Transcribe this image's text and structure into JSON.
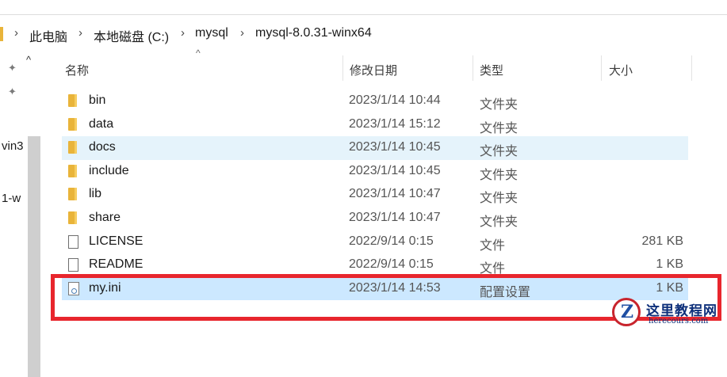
{
  "breadcrumb": {
    "separator": "›",
    "items": [
      "此电脑",
      "本地磁盘 (C:)",
      "mysql",
      "mysql-8.0.31-winx64"
    ]
  },
  "nav": {
    "fragments": [
      "vin3",
      "1-w"
    ],
    "pin_icon": "pin-icon",
    "scroll_up_glyph": "^"
  },
  "columns": {
    "name": "名称",
    "modified": "修改日期",
    "type": "类型",
    "size": "大小",
    "sort_glyph": "^"
  },
  "files": [
    {
      "name": "bin",
      "modified": "2023/1/14 10:44",
      "type": "文件夹",
      "size": "",
      "icon": "folder-icon"
    },
    {
      "name": "data",
      "modified": "2023/1/14 15:12",
      "type": "文件夹",
      "size": "",
      "icon": "folder-icon"
    },
    {
      "name": "docs",
      "modified": "2023/1/14 10:45",
      "type": "文件夹",
      "size": "",
      "icon": "folder-icon"
    },
    {
      "name": "include",
      "modified": "2023/1/14 10:45",
      "type": "文件夹",
      "size": "",
      "icon": "folder-icon"
    },
    {
      "name": "lib",
      "modified": "2023/1/14 10:47",
      "type": "文件夹",
      "size": "",
      "icon": "folder-icon"
    },
    {
      "name": "share",
      "modified": "2023/1/14 10:47",
      "type": "文件夹",
      "size": "",
      "icon": "folder-icon"
    },
    {
      "name": "LICENSE",
      "modified": "2022/9/14 0:15",
      "type": "文件",
      "size": "281 KB",
      "icon": "file-icon"
    },
    {
      "name": "README",
      "modified": "2022/9/14 0:15",
      "type": "文件",
      "size": "1 KB",
      "icon": "file-icon"
    },
    {
      "name": "my.ini",
      "modified": "2023/1/14 14:53",
      "type": "配置设置",
      "size": "1 KB",
      "icon": "config-file-icon"
    }
  ],
  "watermark": {
    "letter": "Z",
    "title": "这里教程网",
    "domain": "herecours.com"
  },
  "colors": {
    "highlight": "#e8262d",
    "selected_row": "#cce8ff",
    "hover_row": "#e5f3fb",
    "folder": "#e9b43a"
  }
}
